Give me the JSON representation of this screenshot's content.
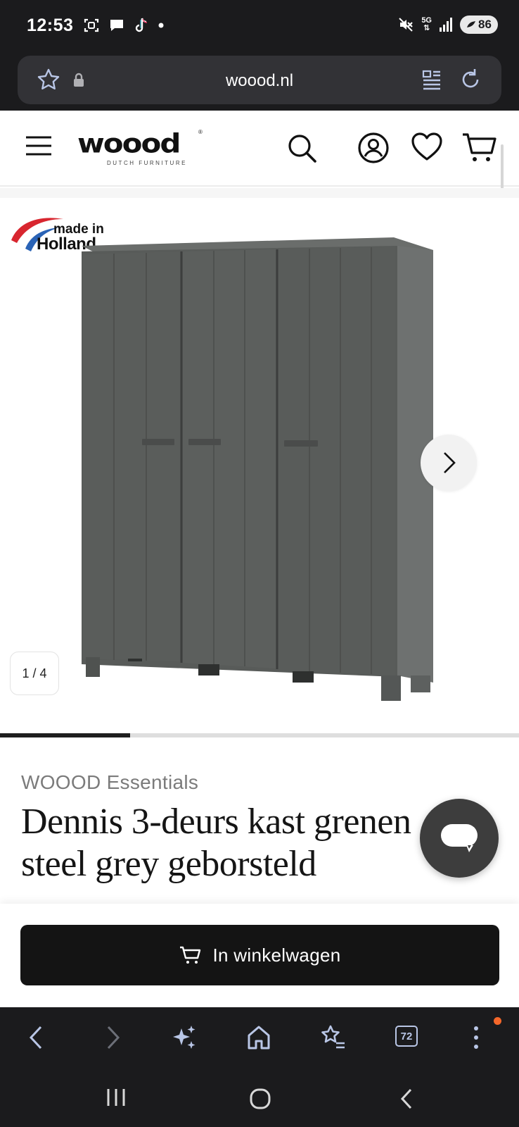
{
  "status_bar": {
    "time": "12:53",
    "network": "5G",
    "battery": "86",
    "icons_left": [
      "screenshot-icon",
      "chat-bubble-icon",
      "tiktok-icon",
      "dot-icon"
    ],
    "icons_right": [
      "mute-icon",
      "signal-icon",
      "battery-icon"
    ]
  },
  "browser": {
    "url": "woood.nl",
    "toolbar": {
      "items": [
        "back-icon",
        "forward-icon",
        "ai-sparkle-icon",
        "home-icon",
        "bookmarks-icon",
        "tabs-icon",
        "more-icon"
      ],
      "tab_count": "72"
    }
  },
  "site": {
    "logo_text": "woood",
    "logo_subtitle": "DUTCH FURNITURE",
    "logo_reg": "®"
  },
  "gallery": {
    "badge_line1": "made in",
    "badge_line2": "Holland",
    "counter": "1 / 4",
    "current_index": 1,
    "total_images": 4,
    "progress_fraction": 0.25
  },
  "product": {
    "brand": "WOOOD Essentials",
    "title_line1": "Dennis 3-deurs kast grenen",
    "title_line2": "steel grey geborsteld"
  },
  "cart": {
    "button_label": "In winkelwagen"
  },
  "colors": {
    "accent": "#141414",
    "chrome": "#1b1b1d",
    "wardrobe": "#5b5e5c",
    "notification": "#f5672a",
    "toolbar_icons": "#b9c6e6"
  }
}
